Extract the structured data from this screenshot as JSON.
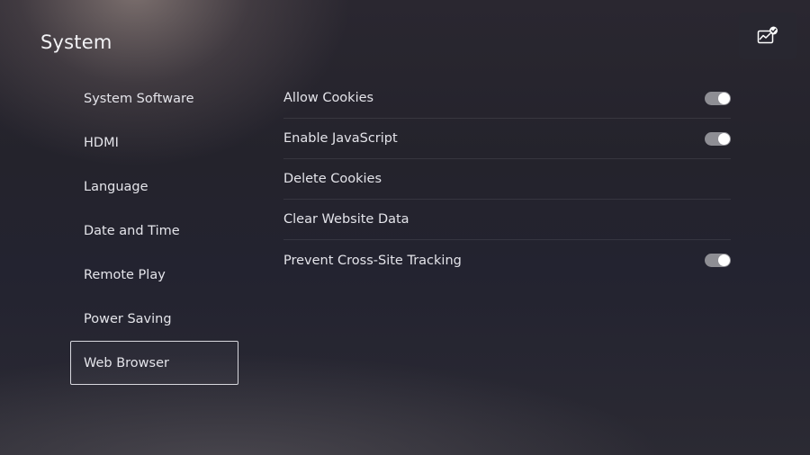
{
  "header": {
    "title": "System",
    "status_icon": "chart-check-icon"
  },
  "sidebar": {
    "items": [
      {
        "label": "System Software"
      },
      {
        "label": "HDMI"
      },
      {
        "label": "Language"
      },
      {
        "label": "Date and Time"
      },
      {
        "label": "Remote Play"
      },
      {
        "label": "Power Saving"
      },
      {
        "label": "Web Browser",
        "selected": true
      }
    ]
  },
  "settings": {
    "items": [
      {
        "label": "Allow Cookies",
        "toggle": true
      },
      {
        "label": "Enable JavaScript",
        "toggle": true
      },
      {
        "label": "Delete Cookies"
      },
      {
        "label": "Clear Website Data"
      },
      {
        "label": "Prevent Cross-Site Tracking",
        "toggle": true
      }
    ]
  },
  "colors": {
    "toggle_track": "#8e8e94",
    "toggle_knob": "#ffffff",
    "selection_border": "#d8d8de"
  }
}
